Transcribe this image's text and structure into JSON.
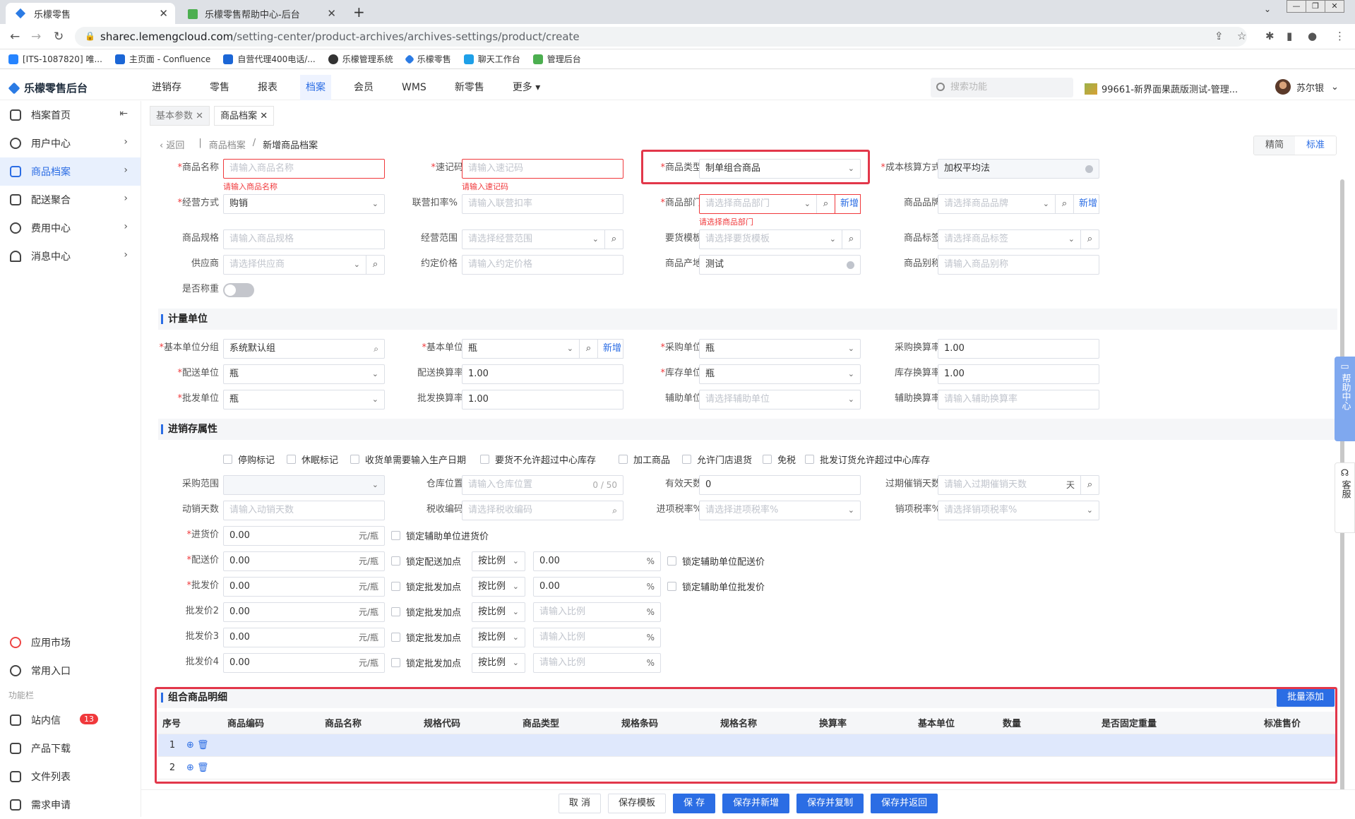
{
  "browser": {
    "tabs": [
      {
        "title": "乐檬零售"
      },
      {
        "title": "乐檬零售帮助中心-后台"
      }
    ],
    "url_host": "sharec.lemengcloud.com",
    "url_path": "/setting-center/product-archives/archives-settings/product/create",
    "bookmarks": [
      "[ITS-1087820] 唯...",
      "主页面 - Confluence",
      "自营代理400电话/...",
      "乐檬管理系统",
      "乐檬零售",
      "聊天工作台",
      "管理后台"
    ]
  },
  "app": {
    "logo": "乐檬零售后台",
    "menu": [
      "进销存",
      "零售",
      "报表",
      "档案",
      "会员",
      "WMS",
      "新零售",
      "更多"
    ],
    "search_placeholder": "搜索功能",
    "store": "99661-新界面果蔬版测试-管理...",
    "user": "苏尔银"
  },
  "sidebar": {
    "items": [
      "档案首页",
      "用户中心",
      "商品档案",
      "配送聚合",
      "费用中心",
      "消息中心"
    ],
    "bottom": [
      "应用市场",
      "常用入口"
    ],
    "group": "功能栏",
    "func": [
      "站内信",
      "产品下载",
      "文件列表",
      "需求申请"
    ],
    "badge": "13"
  },
  "page": {
    "tabs": [
      "基本参数",
      "商品档案"
    ],
    "crumb_back": "返回",
    "crumb_parent": "商品档案",
    "crumb_current": "新增商品档案",
    "mode": [
      "精简",
      "标准"
    ]
  },
  "basic": {
    "name_label": "商品名称",
    "name_ph": "请输入商品名称",
    "name_err": "请输入商品名称",
    "code_label": "速记码",
    "code_ph": "请输入速记码",
    "code_err": "请输入速记码",
    "type_label": "商品类型",
    "type_val": "制单组合商品",
    "cost_label": "成本核算方式",
    "cost_val": "加权平均法",
    "mode_label": "经营方式",
    "mode_val": "购销",
    "rate_label": "联营扣率%",
    "rate_ph": "请输入联营扣率",
    "dept_label": "商品部门",
    "dept_ph": "请选择商品部门",
    "dept_err": "请选择商品部门",
    "add": "新增",
    "brand_label": "商品品牌",
    "brand_ph": "请选择商品品牌",
    "spec_label": "商品规格",
    "spec_ph": "请输入商品规格",
    "scope_label": "经营范围",
    "scope_ph": "请选择经营范围",
    "tpl_label": "要货模板",
    "tpl_ph": "请选择要货模板",
    "tag_label": "商品标签",
    "tag_ph": "请选择商品标签",
    "sup_label": "供应商",
    "sup_ph": "请选择供应商",
    "price_label": "约定价格",
    "price_ph": "请输入约定价格",
    "origin_label": "商品产地",
    "origin_val": "测试",
    "alias_label": "商品别称",
    "alias_ph": "请输入商品别称",
    "weigh_label": "是否称重"
  },
  "unit": {
    "title": "计量单位",
    "grp_label": "基本单位分组",
    "grp_val": "系统默认组",
    "base_label": "基本单位",
    "base_val": "瓶",
    "buy_label": "采购单位",
    "buy_val": "瓶",
    "buyrate_label": "采购换算率",
    "buyrate_val": "1.00",
    "del_label": "配送单位",
    "del_val": "瓶",
    "delrate_label": "配送换算率",
    "delrate_val": "1.00",
    "stock_label": "库存单位",
    "stock_val": "瓶",
    "stockrate_label": "库存换算率",
    "stockrate_val": "1.00",
    "whs_label": "批发单位",
    "whs_val": "瓶",
    "whsrate_label": "批发换算率",
    "whsrate_val": "1.00",
    "aux_label": "辅助单位",
    "aux_ph": "请选择辅助单位",
    "auxrate_label": "辅助换算率",
    "auxrate_ph": "请输入辅助换算率"
  },
  "inv": {
    "title": "进销存属性",
    "checks": [
      "停购标记",
      "休眠标记",
      "收货单需要输入生产日期",
      "要货不允许超过中心库存",
      "加工商品",
      "允许门店退货",
      "免税",
      "批发订货允许超过中心库存"
    ],
    "range_label": "采购范围",
    "loc_label": "仓库位置",
    "loc_ph": "请输入仓库位置",
    "loc_cnt": "0 / 50",
    "valid_label": "有效天数",
    "valid_val": "0",
    "expire_label": "过期催销天数",
    "expire_ph": "请输入过期催销天数",
    "day": "天",
    "move_label": "动销天数",
    "move_ph": "请输入动销天数",
    "tax_label": "税收编码",
    "tax_ph": "请选择税收编码",
    "intax_label": "进项税率%",
    "intax_ph": "请选择进项税率%",
    "outtax_label": "销项税率%",
    "outtax_ph": "请选择销项税率%",
    "unit_suffix": "元/瓶",
    "pct": "%",
    "ratio": "按比例",
    "ratio_ph": "请输入比例",
    "prices": [
      {
        "label": "进货价",
        "val": "0.00",
        "req": true,
        "lock": "锁定辅助单位进货价"
      },
      {
        "label": "配送价",
        "val": "0.00",
        "req": true,
        "lock": "锁定配送加点",
        "rate": "0.00",
        "lock2": "锁定辅助单位配送价"
      },
      {
        "label": "批发价",
        "val": "0.00",
        "req": true,
        "lock": "锁定批发加点",
        "rate": "0.00",
        "lock2": "锁定辅助单位批发价"
      },
      {
        "label": "批发价2",
        "val": "0.00",
        "req": false,
        "lock": "锁定批发加点"
      },
      {
        "label": "批发价3",
        "val": "0.00",
        "req": false,
        "lock": "锁定批发加点"
      },
      {
        "label": "批发价4",
        "val": "0.00",
        "req": false,
        "lock": "锁定批发加点"
      }
    ]
  },
  "combo": {
    "title": "组合商品明细",
    "batch": "批量添加",
    "columns": [
      "序号",
      "商品编码",
      "商品名称",
      "规格代码",
      "商品类型",
      "规格条码",
      "规格名称",
      "换算率",
      "基本单位",
      "数量",
      "是否固定重量",
      "标准售价"
    ],
    "rows": [
      "1",
      "2"
    ]
  },
  "actions": [
    "取 消",
    "保存模板",
    "保 存",
    "保存并新增",
    "保存并复制",
    "保存并返回"
  ],
  "float": {
    "help": "帮助中心",
    "service": "客服"
  },
  "colors": {
    "primary": "#2b6de4",
    "error": "#f0393c",
    "highlight": "#e2374a"
  }
}
